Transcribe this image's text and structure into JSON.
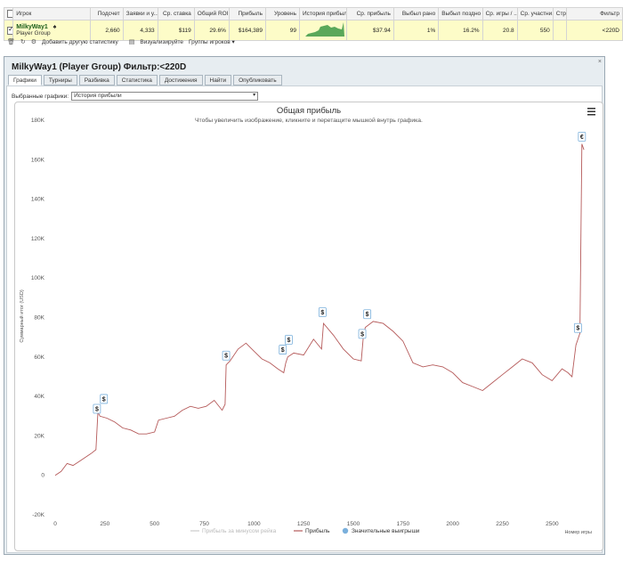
{
  "stats": {
    "headers": [
      "Игрок",
      "Подсчет",
      "Заявки и у...",
      "Ср. ставка",
      "Общий ROI",
      "Прибыль",
      "Уровень",
      "История прибыли",
      "Ср. прибыль",
      "Выбыл рано",
      "Выбыл поздно",
      "Ср. игры / ...",
      "Ср. участни...",
      "Стр",
      "Фильтр"
    ],
    "row": {
      "player": "MilkyWay1",
      "group": "Player Group",
      "count": "2,660",
      "entries": "4,333",
      "avg_stake": "$119",
      "roi": "29.6%",
      "profit": "$164,389",
      "level": "99",
      "avg_profit": "$37.94",
      "early": "1%",
      "late": "16.2%",
      "avg_games": "20.8",
      "avg_participants": "550",
      "str": "",
      "filter": "<220D"
    }
  },
  "toolbar": {
    "add_stats": "Добавить другую статистику",
    "visualize": "Визуализируйте",
    "player_groups": "Группы игроков"
  },
  "window": {
    "title": "MilkyWay1 (Player Group) Фильтр:<220D",
    "tabs": [
      "Графики",
      "Турниры",
      "Разбивка",
      "Статистика",
      "Достижения",
      "Найти",
      "Опубликовать"
    ],
    "select_label": "Выбранные графики:",
    "select_value": "История прибыли"
  },
  "chart_data": {
    "type": "line",
    "title": "Общая прибыль",
    "subtitle": "Чтобы увеличить изображение, кликните и перетащите мышкой внутрь графика.",
    "ylabel": "Суммарный итог (USD)",
    "xlabel": "Номер игры",
    "xlim": [
      0,
      2700
    ],
    "ylim": [
      -20000,
      180000
    ],
    "x_ticks": [
      0,
      250,
      500,
      750,
      1000,
      1250,
      1500,
      1750,
      2000,
      2250,
      2500
    ],
    "y_ticks": [
      "-20K",
      "0",
      "20K",
      "40K",
      "60K",
      "80K",
      "100K",
      "120K",
      "140K",
      "160K",
      "180K"
    ],
    "y_tick_values": [
      -20000,
      0,
      20000,
      40000,
      60000,
      80000,
      100000,
      120000,
      140000,
      160000,
      180000
    ],
    "legend": [
      "Прибыль за минусом рейка",
      "Прибыль",
      "Значительные выигрыши"
    ],
    "series": [
      {
        "name": "Прибыль",
        "color": "#b55a5a",
        "x": [
          0,
          30,
          60,
          90,
          120,
          150,
          180,
          205,
          215,
          225,
          260,
          300,
          340,
          380,
          420,
          460,
          500,
          520,
          560,
          600,
          640,
          680,
          720,
          760,
          800,
          840,
          855,
          860,
          880,
          920,
          960,
          1000,
          1040,
          1080,
          1120,
          1150,
          1160,
          1170,
          1200,
          1250,
          1300,
          1340,
          1350,
          1400,
          1450,
          1500,
          1540,
          1550,
          1560,
          1600,
          1650,
          1700,
          1750,
          1800,
          1850,
          1900,
          1950,
          2000,
          2050,
          2100,
          2150,
          2200,
          2250,
          2300,
          2350,
          2400,
          2450,
          2500,
          2550,
          2580,
          2600,
          2620,
          2640,
          2650,
          2660
        ],
        "y": [
          0,
          2000,
          6000,
          5000,
          7000,
          9000,
          11000,
          13000,
          32000,
          30000,
          29000,
          27000,
          24000,
          23000,
          21000,
          21000,
          22000,
          28000,
          29000,
          30000,
          33000,
          35000,
          34000,
          35000,
          38000,
          33000,
          36000,
          56000,
          58000,
          64000,
          67000,
          63000,
          59000,
          57000,
          54000,
          52000,
          57000,
          60000,
          62000,
          61000,
          69000,
          64000,
          77000,
          71000,
          64000,
          59000,
          58000,
          70000,
          75000,
          78000,
          77000,
          73000,
          68000,
          57000,
          55000,
          56000,
          55000,
          52000,
          47000,
          45000,
          43000,
          47000,
          51000,
          55000,
          59000,
          57000,
          51000,
          48000,
          54000,
          52000,
          50000,
          66000,
          72000,
          168000,
          165000
        ]
      }
    ],
    "big_wins": [
      {
        "x": 210,
        "y": 31000,
        "label": "$"
      },
      {
        "x": 245,
        "y": 36000,
        "label": "$"
      },
      {
        "x": 860,
        "y": 58000,
        "label": "$"
      },
      {
        "x": 1145,
        "y": 61000,
        "label": "$"
      },
      {
        "x": 1175,
        "y": 66000,
        "label": "$"
      },
      {
        "x": 1345,
        "y": 80000,
        "label": "$"
      },
      {
        "x": 1545,
        "y": 69000,
        "label": "$"
      },
      {
        "x": 1570,
        "y": 79000,
        "label": "$"
      },
      {
        "x": 2630,
        "y": 72000,
        "label": "$"
      },
      {
        "x": 2650,
        "y": 169000,
        "label": "€"
      }
    ]
  }
}
